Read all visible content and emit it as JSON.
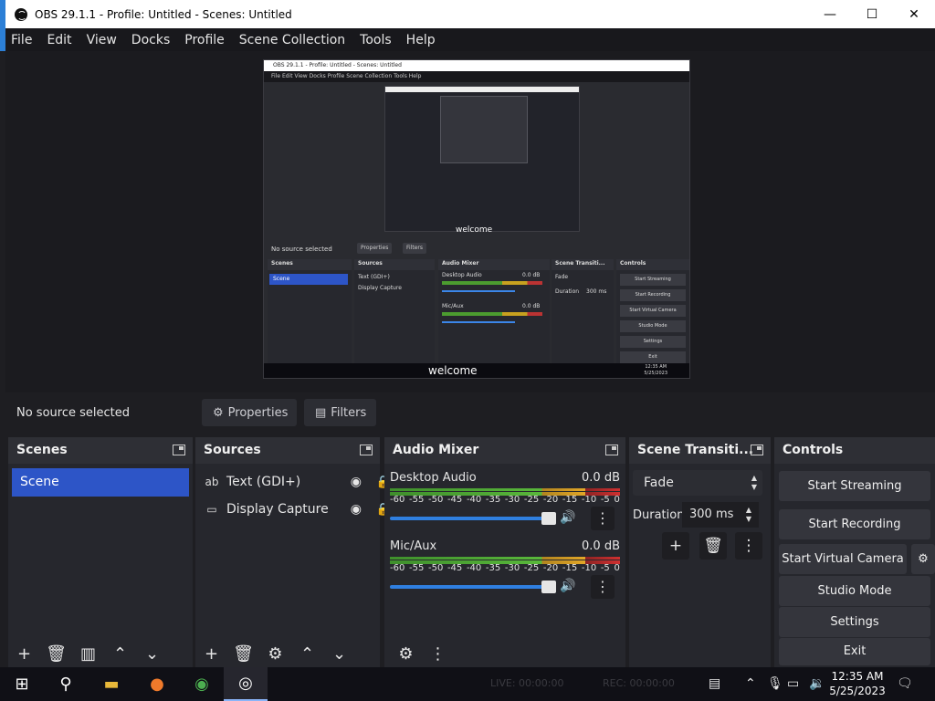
{
  "window": {
    "title": "OBS 29.1.1 - Profile: Untitled - Scenes: Untitled"
  },
  "menu": [
    "File",
    "Edit",
    "View",
    "Docks",
    "Profile",
    "Scene Collection",
    "Tools",
    "Help"
  ],
  "preview": {
    "nested_title": "OBS 29.1.1 - Profile: Untitled - Scenes: Untitled",
    "nested_menu": "File   Edit   View   Docks   Profile   Scene Collection   Tools   Help",
    "welcome_inner": "welcome",
    "welcome_taskbar": "welcome",
    "nested_no_source": "No source selected",
    "nested_properties": "Properties",
    "nested_filters": "Filters",
    "nested_panels": {
      "scenes": "Scenes",
      "sources": "Sources",
      "audio": "Audio Mixer",
      "transitions": "Scene Transiti...",
      "controls": "Controls"
    },
    "nested_scene": "Scene",
    "nested_sources": [
      "Text (GDI+)",
      "Display Capture"
    ],
    "nested_audio": [
      "Desktop Audio",
      "Mic/Aux"
    ],
    "nested_db": "0.0 dB",
    "nested_fade": "Fade",
    "nested_duration": "Duration",
    "nested_duration_value": "300 ms",
    "nested_controls": [
      "Start Streaming",
      "Start Recording",
      "Start Virtual Camera",
      "Studio Mode",
      "Settings",
      "Exit"
    ],
    "nested_clock": [
      "12:35 AM",
      "5/25/2023"
    ]
  },
  "source_toolbar": {
    "status": "No source selected",
    "properties": "Properties",
    "filters": "Filters"
  },
  "scenes": {
    "title": "Scenes",
    "items": [
      "Scene"
    ]
  },
  "sources": {
    "title": "Sources",
    "items": [
      {
        "label": "Text (GDI+)",
        "icon": "text-icon"
      },
      {
        "label": "Display Capture",
        "icon": "monitor-icon"
      }
    ]
  },
  "audio": {
    "title": "Audio Mixer",
    "scale": [
      "-60",
      "-55",
      "-50",
      "-45",
      "-40",
      "-35",
      "-30",
      "-25",
      "-20",
      "-15",
      "-10",
      "-5",
      "0"
    ],
    "channels": [
      {
        "name": "Desktop Audio",
        "db": "0.0 dB",
        "level": 1.0
      },
      {
        "name": "Mic/Aux",
        "db": "0.0 dB",
        "level": 1.0
      }
    ]
  },
  "transitions": {
    "title": "Scene Transiti...",
    "selected": "Fade",
    "duration_label": "Duration",
    "duration_value": "300 ms"
  },
  "controls": {
    "title": "Controls",
    "buttons": [
      "Start Streaming",
      "Start Recording",
      "Start Virtual Camera",
      "Studio Mode",
      "Settings",
      "Exit"
    ]
  },
  "taskbar": {
    "live": "LIVE: 00:00:00",
    "rec": "REC: 00:00:00",
    "time": "12:35 AM",
    "date": "5/25/2023"
  },
  "colors": {
    "accent": "#2d55c7",
    "titlebar_edge": "#2c7fd6",
    "panel": "#26272d"
  }
}
